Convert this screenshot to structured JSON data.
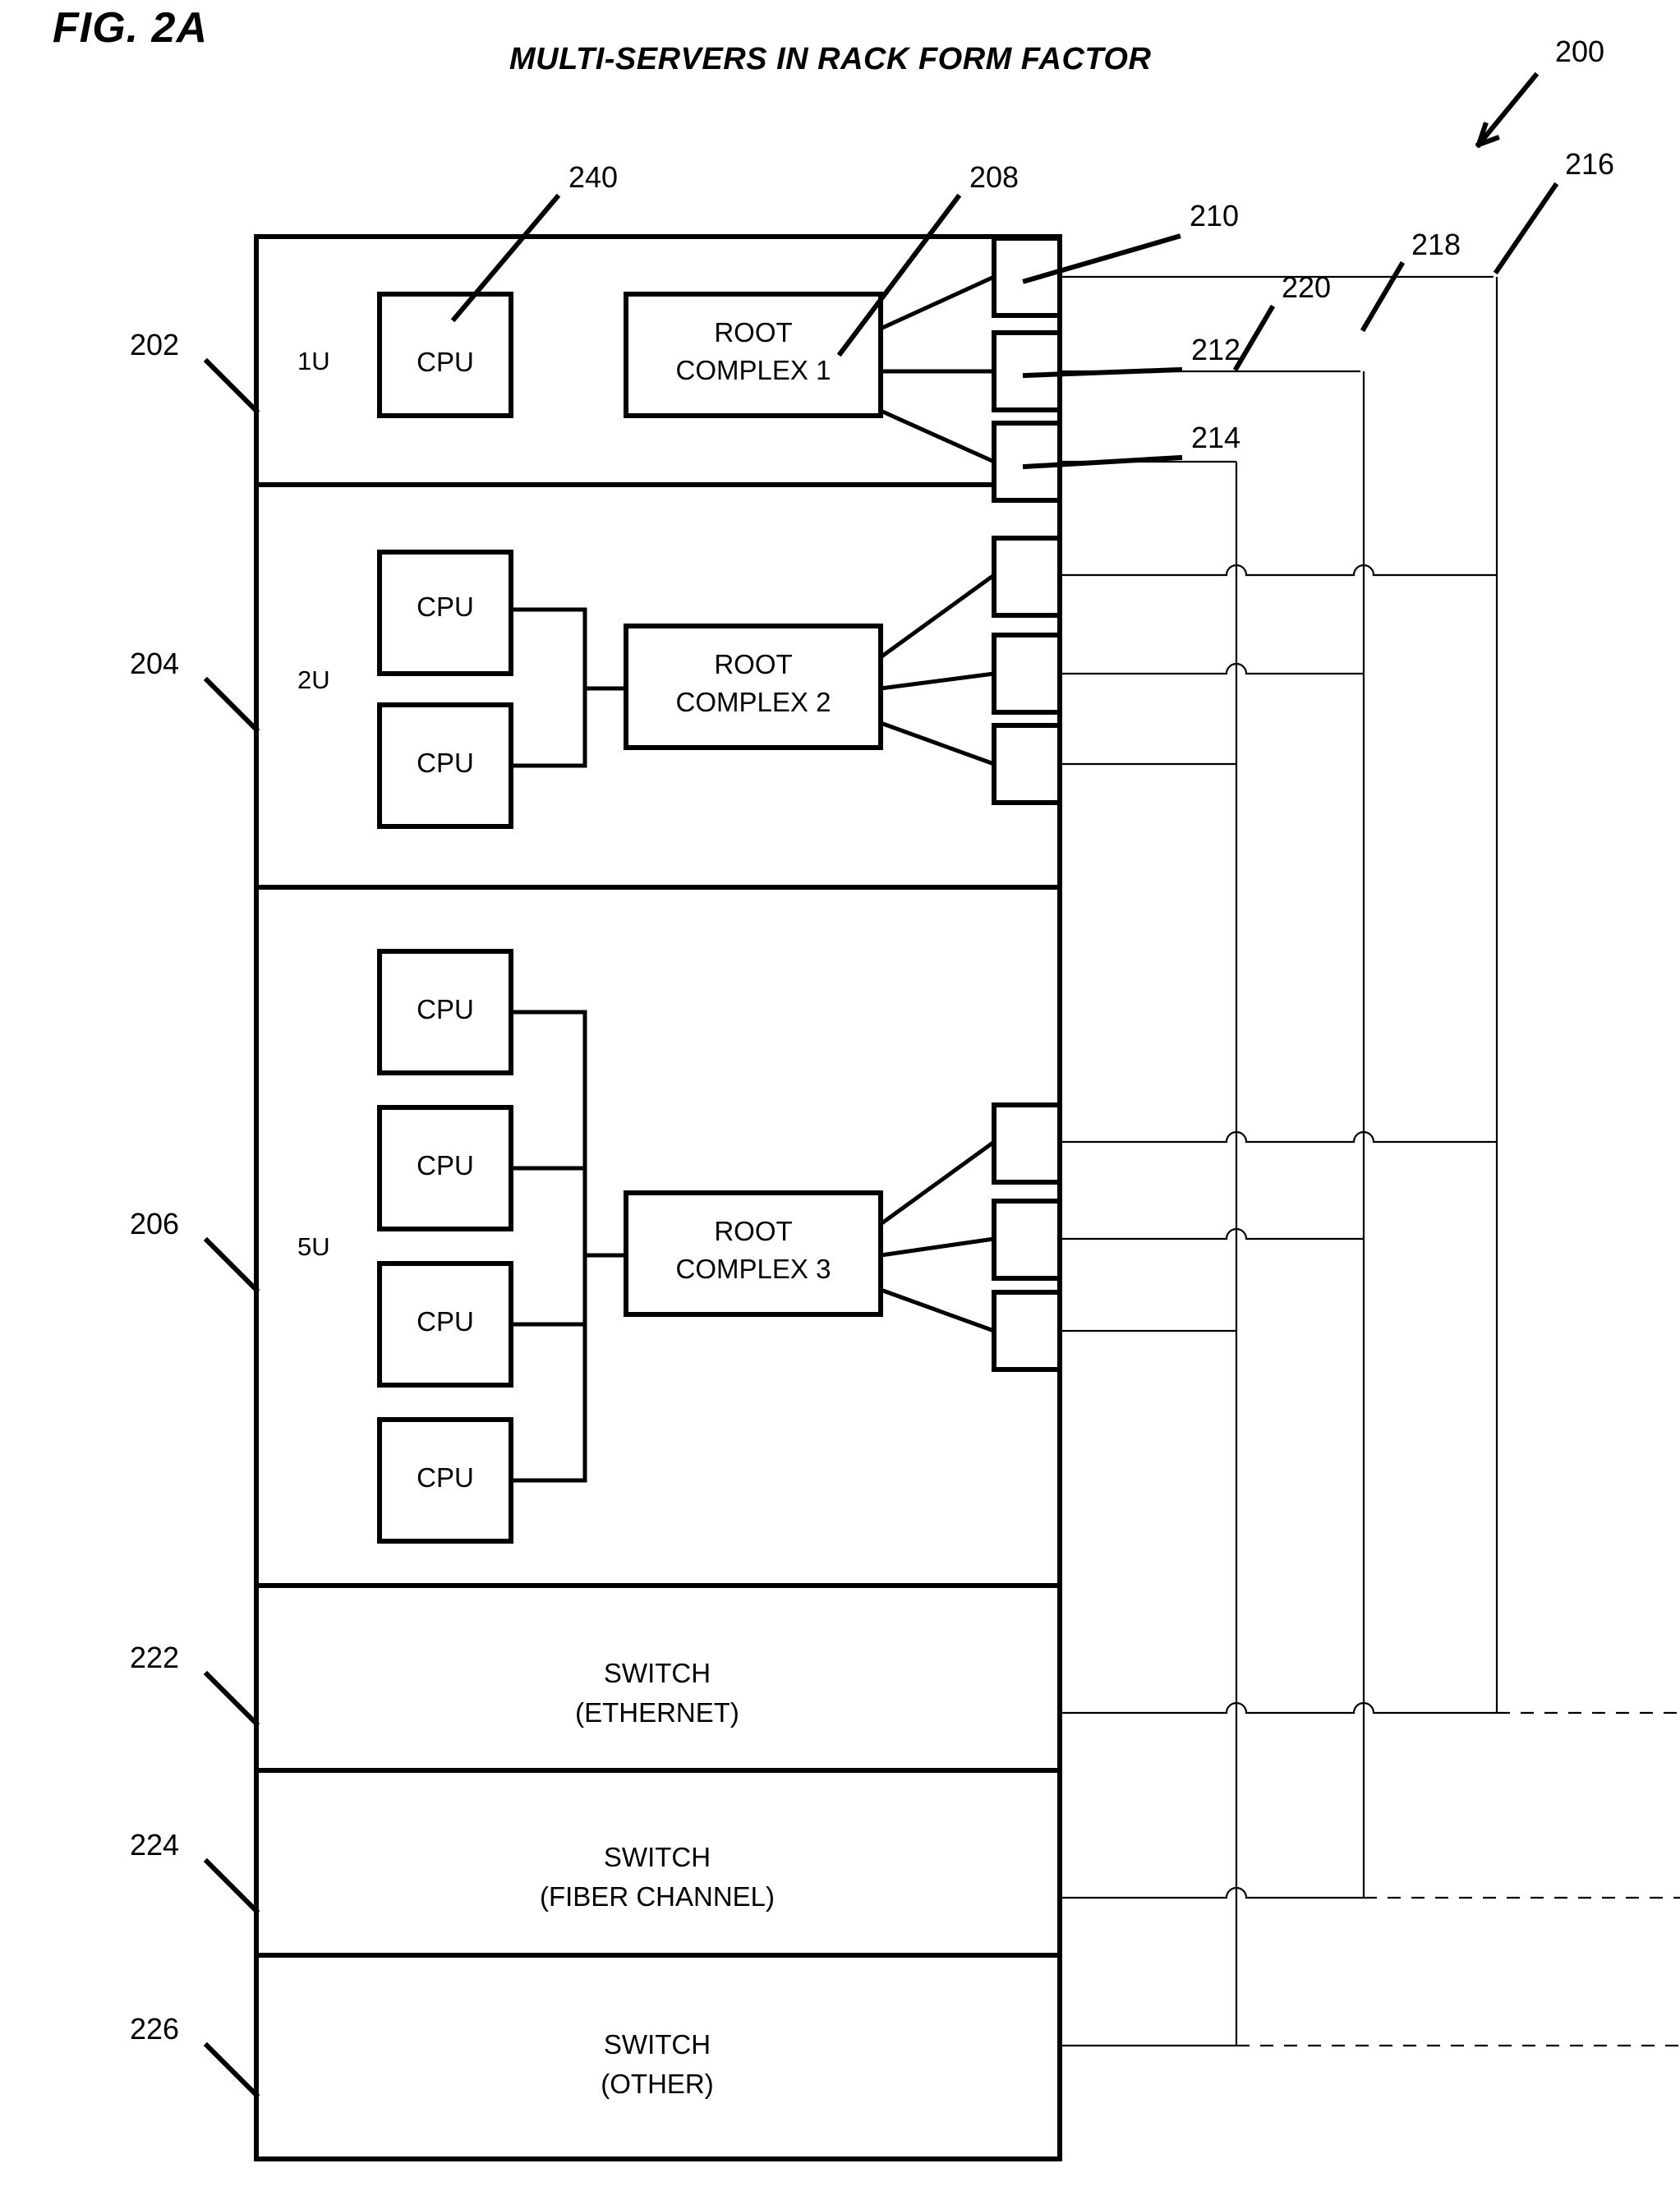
{
  "figure": {
    "figure_label": "FIG. 2A",
    "title": "MULTI-SERVERS IN RACK FORM FACTOR",
    "overall_ref": "200"
  },
  "refs": {
    "r200": "200",
    "r202": "202",
    "r204": "204",
    "r206": "206",
    "r208": "208",
    "r210": "210",
    "r212": "212",
    "r214": "214",
    "r216": "216",
    "r218": "218",
    "r220": "220",
    "r222": "222",
    "r224": "224",
    "r226": "226",
    "r240": "240"
  },
  "rack": {
    "servers": [
      {
        "ref": "202",
        "unit_label": "1U",
        "cpus": [
          "CPU"
        ],
        "root_complex": "ROOT\nCOMPLEX 1",
        "root_complex_line1": "ROOT",
        "root_complex_line2": "COMPLEX 1",
        "port_count": 3,
        "port_refs": [
          "210",
          "212",
          "214"
        ],
        "root_complex_ref": "208",
        "cpu_ref": "240"
      },
      {
        "ref": "204",
        "unit_label": "2U",
        "cpus": [
          "CPU",
          "CPU"
        ],
        "root_complex_line1": "ROOT",
        "root_complex_line2": "COMPLEX 2",
        "port_count": 3
      },
      {
        "ref": "206",
        "unit_label": "5U",
        "cpus": [
          "CPU",
          "CPU",
          "CPU",
          "CPU"
        ],
        "root_complex_line1": "ROOT",
        "root_complex_line2": "COMPLEX 3",
        "port_count": 3
      }
    ],
    "switches": [
      {
        "ref": "222",
        "line1": "SWITCH",
        "line2": "(ETHERNET)"
      },
      {
        "ref": "224",
        "line1": "SWITCH",
        "line2": "(FIBER CHANNEL)"
      },
      {
        "ref": "226",
        "line1": "SWITCH",
        "line2": "(OTHER)"
      }
    ],
    "cable_bundles": [
      {
        "ref": "216",
        "name": "ethernet-cable-bundle"
      },
      {
        "ref": "218",
        "name": "fiber-channel-cable-bundle"
      },
      {
        "ref": "220",
        "name": "other-cable-bundle"
      }
    ]
  },
  "colors": {
    "stroke": "#000000",
    "background": "#ffffff"
  }
}
